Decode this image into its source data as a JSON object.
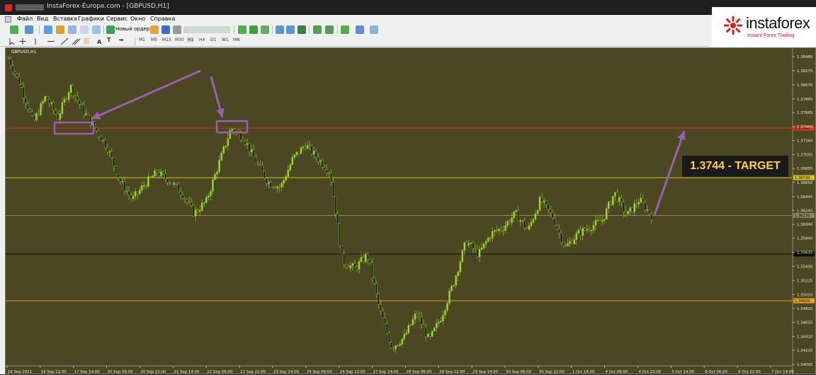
{
  "window": {
    "title": "InstaForex-Europe.com - [GBPUSD,H1]"
  },
  "menu": [
    "Файл",
    "Вид",
    "Вставка",
    "Графики",
    "Сервис",
    "Окно",
    "Справка"
  ],
  "toolbar": {
    "new_order_label": "Новый ордер",
    "timeframes": [
      "M1",
      "M5",
      "M15",
      "M30",
      "H1",
      "H4",
      "D1",
      "W1",
      "MN"
    ],
    "active_timeframe": "H1"
  },
  "logo": {
    "brand": "instaforex",
    "tagline": "Instant Forex Trading"
  },
  "chart": {
    "symbol_label": "GBPUSD,H1",
    "target_label": "1.3744 - TARGET",
    "background_color": "#4a4722",
    "candle_up_color": "#9fd82e",
    "candle_down_color": "#000000",
    "arrow_color": "#9b5fb0",
    "target_text_color": "#ffd24a"
  },
  "chart_data": {
    "type": "candlestick",
    "symbol": "GBPUSD",
    "timeframe": "H1",
    "ylim": [
      1.34005,
      1.3848
    ],
    "y_ticks": [
      "1.38480",
      "1.38275",
      "1.38070",
      "1.37865",
      "1.37665",
      "1.37460",
      "1.37260",
      "1.37055",
      "1.36855",
      "1.36650",
      "1.36445",
      "1.36245",
      "1.36040",
      "1.35840",
      "1.35635",
      "1.35430",
      "1.35225",
      "1.35020",
      "1.34820",
      "1.34615",
      "1.34410",
      "1.34210",
      "1.34005"
    ],
    "x_labels": [
      "16 Sep 2021",
      "16 Sep 22:00",
      "17 Sep 14:00",
      "20 Sep 06:00",
      "20 Sep 22:00",
      "21 Sep 14:00",
      "22 Sep 06:00",
      "22 Sep 22:00",
      "23 Sep 14:00",
      "24 Sep 06:00",
      "24 Sep 22:00",
      "27 Sep 14:00",
      "28 Sep 06:00",
      "28 Sep 22:00",
      "29 Sep 14:00",
      "30 Sep 06:00",
      "30 Sep 22:00",
      "1 Oct 14:00",
      "4 Oct 06:00",
      "4 Oct 22:00",
      "5 Oct 14:00",
      "6 Oct 06:00",
      "6 Oct 22:00",
      "7 Oct 14:00"
    ],
    "horizontal_lines": [
      {
        "price": 1.3744,
        "color": "#d33a1f",
        "tag": "1.37440"
      },
      {
        "price": 1.3672,
        "color": "#d4c030",
        "tag": "1.36720"
      },
      {
        "price": 1.3617,
        "color": "#8a8a60",
        "tag": "1.36170"
      },
      {
        "price": 1.3561,
        "color": "#111111",
        "tag": "1.35610"
      },
      {
        "price": 1.3493,
        "color": "#e6a020",
        "tag": "1.34929"
      }
    ],
    "current_price": 1.3617,
    "target_price": 1.3744,
    "price_path": [
      1.3845,
      1.3805,
      1.3752,
      1.379,
      1.376,
      1.3805,
      1.377,
      1.3744,
      1.3715,
      1.3668,
      1.364,
      1.3662,
      1.368,
      1.3668,
      1.365,
      1.362,
      1.3638,
      1.3692,
      1.3744,
      1.373,
      1.3695,
      1.3665,
      1.3658,
      1.37,
      1.372,
      1.37,
      1.368,
      1.355,
      1.354,
      1.356,
      1.348,
      1.3425,
      1.344,
      1.3475,
      1.3435,
      1.347,
      1.352,
      1.358,
      1.356,
      1.359,
      1.36,
      1.362,
      1.3595,
      1.364,
      1.3615,
      1.357,
      1.359,
      1.36,
      1.361,
      1.365,
      1.3617,
      1.364,
      1.3617
    ]
  }
}
